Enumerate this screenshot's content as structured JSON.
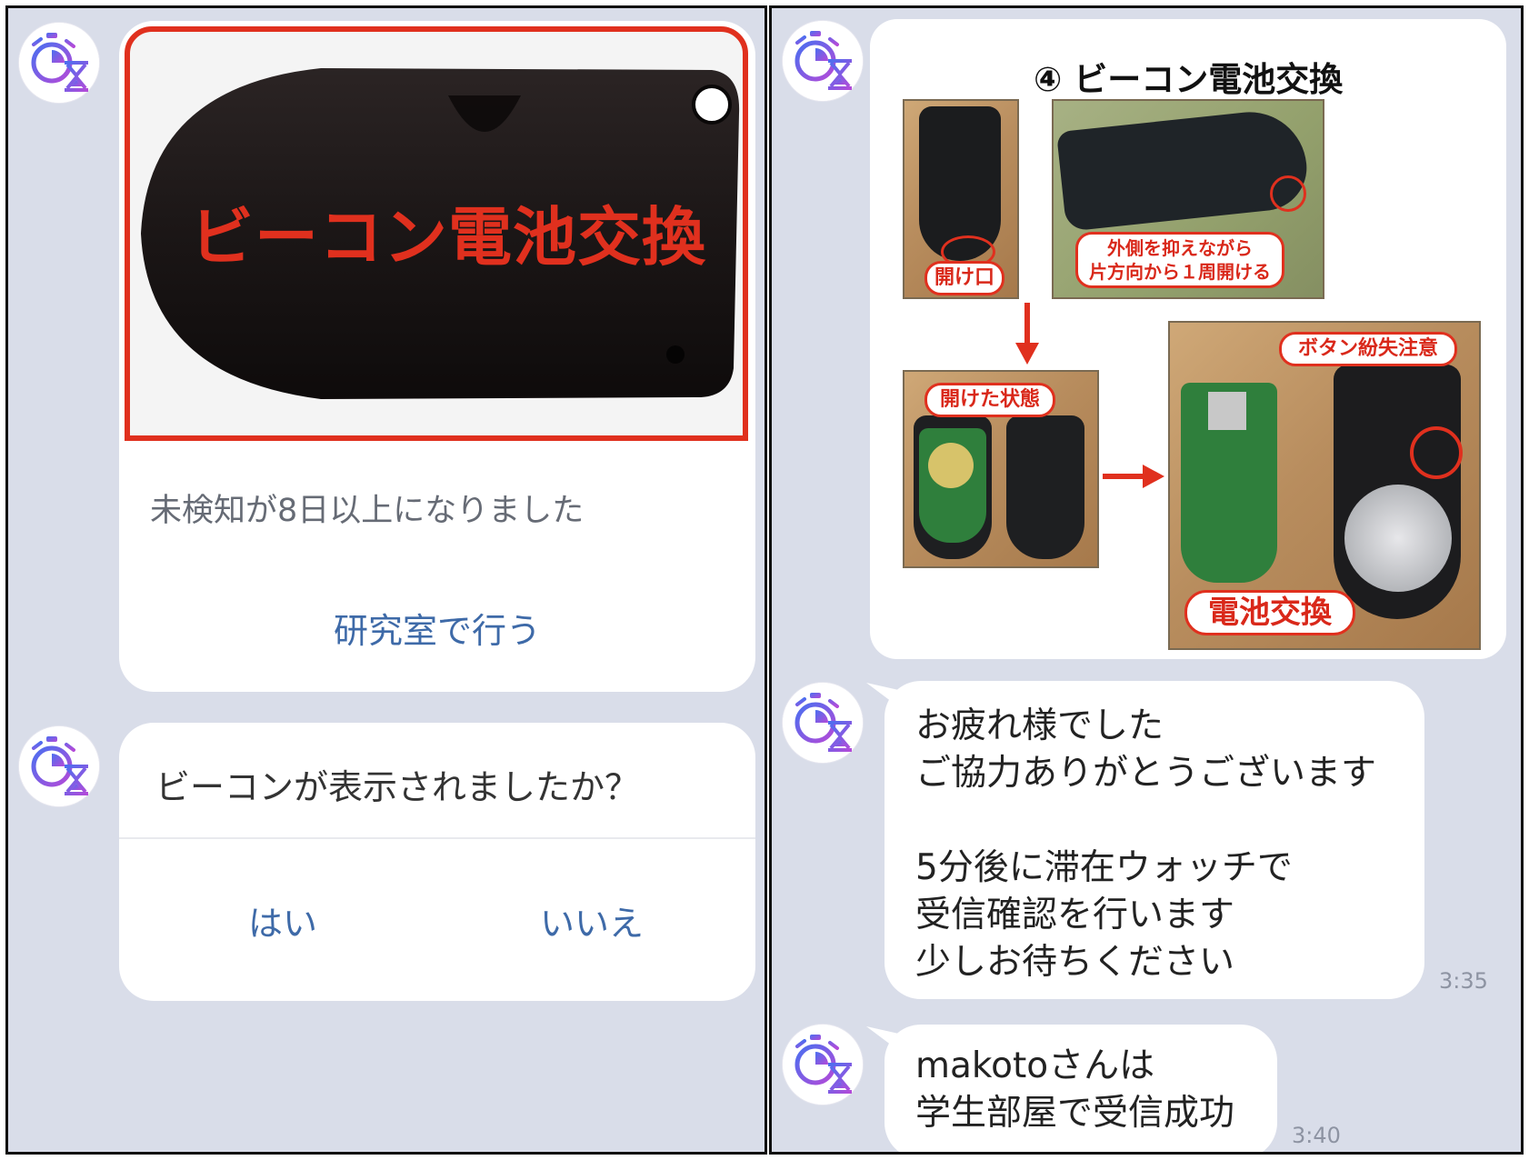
{
  "left": {
    "beacon_card": {
      "image_caption": "ビーコン電池交換",
      "message": "未検知が8日以上になりました",
      "action_label": "研究室で行う"
    },
    "question_card": {
      "question": "ビーコンが表示されましたか？",
      "yes_label": "はい",
      "no_label": "いいえ"
    }
  },
  "right": {
    "guide_image": {
      "title": "④ ビーコン電池交換",
      "label_opening": "開け口",
      "label_outside": "外側を抑えながら\n片方向から１周開ける",
      "label_opened": "開けた状態",
      "label_button_warning": "ボタン紛失注意",
      "label_battery": "電池交換"
    },
    "messages": [
      {
        "text": "お疲れ様でした\nご協力ありがとうございます\n\n5分後に滞在ウォッチで\n受信確認を行います\n少しお待ちください",
        "time": "3:35"
      },
      {
        "text": "makotoさんは\n学生部屋で受信成功",
        "time": "3:40"
      }
    ]
  },
  "colors": {
    "chat_background": "#d9dde9",
    "accent_red": "#e0301e",
    "link_blue": "#3e6aa8",
    "avatar_purple": "#7b4fd9"
  },
  "icons": {
    "avatar": "stopwatch-hourglass-icon",
    "arrow": "red-arrow-icon"
  }
}
